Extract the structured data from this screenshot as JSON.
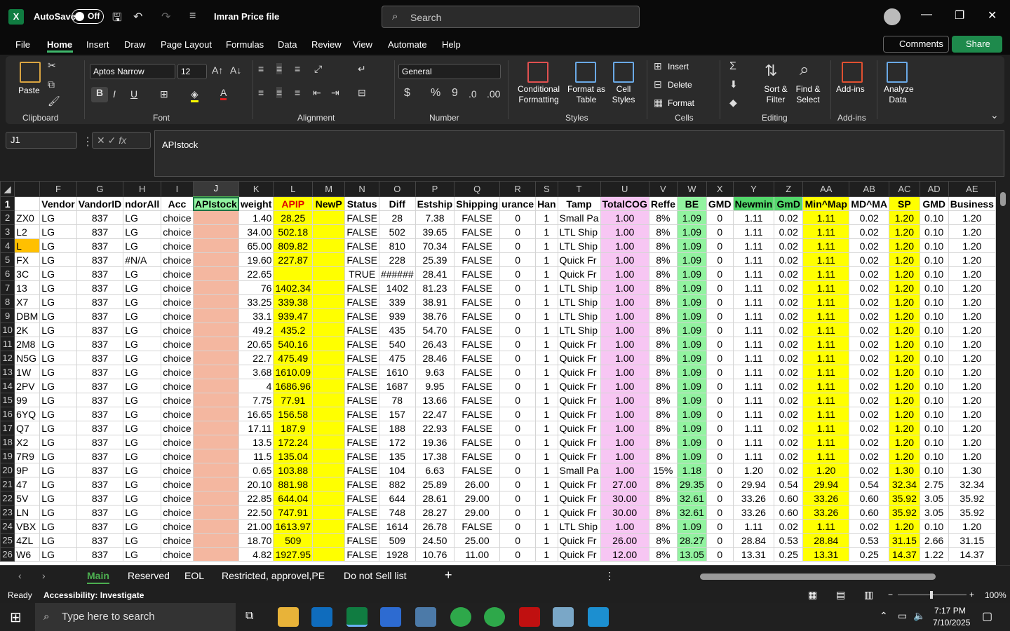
{
  "titlebar": {
    "autosave_label": "AutoSave",
    "autosave_state": "Off",
    "filename": "Imran Price file",
    "search_placeholder": "Search"
  },
  "menu": [
    "File",
    "Home",
    "Insert",
    "Draw",
    "Page Layout",
    "Formulas",
    "Data",
    "Review",
    "View",
    "Automate",
    "Help"
  ],
  "menu_active": "Home",
  "comments_label": "Comments",
  "share_label": "Share",
  "ribbon": {
    "clipboard": {
      "label": "Clipboard",
      "paste": "Paste"
    },
    "font": {
      "label": "Font",
      "name": "Aptos Narrow",
      "size": "12",
      "bold": "B",
      "italic": "I",
      "underline": "U"
    },
    "alignment": {
      "label": "Alignment"
    },
    "number": {
      "label": "Number",
      "format": "General",
      "currency": "$",
      "percent": "%",
      "comma": "9"
    },
    "styles": {
      "label": "Styles",
      "conditional": "Conditional Formatting",
      "format_table": "Format as Table",
      "cell_styles": "Cell Styles"
    },
    "cells": {
      "label": "Cells",
      "insert": "Insert",
      "delete": "Delete",
      "format": "Format"
    },
    "editing": {
      "label": "Editing",
      "sort": "Sort & Filter",
      "find": "Find & Select"
    },
    "addins": {
      "label": "Add-ins",
      "addins": "Add-ins",
      "analyze": "Analyze Data"
    }
  },
  "formula_bar": {
    "name_box": "J1",
    "fx": "fx",
    "content": "APIstock"
  },
  "columns": [
    "F",
    "G",
    "H",
    "I",
    "J",
    "K",
    "L",
    "M",
    "N",
    "O",
    "P",
    "Q",
    "R",
    "S",
    "T",
    "U",
    "V",
    "W",
    "X",
    "Y",
    "Z",
    "AA",
    "AB",
    "AC",
    "AD",
    "AE"
  ],
  "header_row": [
    "Vendor",
    "VandorID",
    "ndorAll",
    "Acc",
    "APIstock",
    "weight",
    "APIP",
    "NewP",
    "Status",
    "Diff",
    "Estship",
    "Shipping",
    "urance",
    "Han",
    "Tamp",
    "TotalCOG",
    "Reffe",
    "BE",
    "GMD",
    "Newmin",
    "GmD",
    "Min^Map",
    "MD^MA",
    "SP",
    "GMD",
    "Business"
  ],
  "rows": [
    {
      "n": "2",
      "e": "ZX0",
      "h": "LG",
      "k": "1.40",
      "l": "28.25",
      "n_": "FALSE",
      "o": "28",
      "p": "7.38",
      "t": "Small Pa",
      "u": "1.00",
      "v": "8%",
      "w": "1.09",
      "y": "1.11",
      "z": "0.02",
      "aa": "1.11",
      "ab": "0.02",
      "ac": "1.20",
      "ad": "0.10",
      "ae": "1.20"
    },
    {
      "n": "3",
      "e": "L2",
      "h": "LG",
      "k": "34.00",
      "l": "502.18",
      "n_": "FALSE",
      "o": "502",
      "p": "39.65",
      "t": "LTL Ship",
      "u": "1.00",
      "v": "8%",
      "w": "1.09",
      "y": "1.11",
      "z": "0.02",
      "aa": "1.11",
      "ab": "0.02",
      "ac": "1.20",
      "ad": "0.10",
      "ae": "1.20"
    },
    {
      "n": "4",
      "e": "L",
      "h": "LG",
      "k": "65.00",
      "l": "809.82",
      "n_": "FALSE",
      "o": "810",
      "p": "70.34",
      "t": "LTL Ship",
      "u": "1.00",
      "v": "8%",
      "w": "1.09",
      "y": "1.11",
      "z": "0.02",
      "aa": "1.11",
      "ab": "0.02",
      "ac": "1.20",
      "ad": "0.10",
      "ae": "1.20"
    },
    {
      "n": "5",
      "e": "FX",
      "h": "#N/A",
      "k": "19.60",
      "l": "227.87",
      "n_": "FALSE",
      "o": "228",
      "p": "25.39",
      "t": "Quick Fr",
      "u": "1.00",
      "v": "8%",
      "w": "1.09",
      "y": "1.11",
      "z": "0.02",
      "aa": "1.11",
      "ab": "0.02",
      "ac": "1.20",
      "ad": "0.10",
      "ae": "1.20"
    },
    {
      "n": "6",
      "e": "3C",
      "h": "LG",
      "k": "22.65",
      "l": "",
      "n_": "TRUE",
      "o": "######",
      "p": "28.41",
      "t": "Quick Fr",
      "u": "1.00",
      "v": "8%",
      "w": "1.09",
      "y": "1.11",
      "z": "0.02",
      "aa": "1.11",
      "ab": "0.02",
      "ac": "1.20",
      "ad": "0.10",
      "ae": "1.20"
    },
    {
      "n": "7",
      "e": "13",
      "h": "LG",
      "k": "76",
      "l": "1402.34",
      "n_": "FALSE",
      "o": "1402",
      "p": "81.23",
      "t": "LTL Ship",
      "u": "1.00",
      "v": "8%",
      "w": "1.09",
      "y": "1.11",
      "z": "0.02",
      "aa": "1.11",
      "ab": "0.02",
      "ac": "1.20",
      "ad": "0.10",
      "ae": "1.20"
    },
    {
      "n": "8",
      "e": "X7",
      "h": "LG",
      "k": "33.25",
      "l": "339.38",
      "n_": "FALSE",
      "o": "339",
      "p": "38.91",
      "t": "LTL Ship",
      "u": "1.00",
      "v": "8%",
      "w": "1.09",
      "y": "1.11",
      "z": "0.02",
      "aa": "1.11",
      "ab": "0.02",
      "ac": "1.20",
      "ad": "0.10",
      "ae": "1.20"
    },
    {
      "n": "9",
      "e": "DBM",
      "h": "LG",
      "k": "33.1",
      "l": "939.47",
      "n_": "FALSE",
      "o": "939",
      "p": "38.76",
      "t": "LTL Ship",
      "u": "1.00",
      "v": "8%",
      "w": "1.09",
      "y": "1.11",
      "z": "0.02",
      "aa": "1.11",
      "ab": "0.02",
      "ac": "1.20",
      "ad": "0.10",
      "ae": "1.20"
    },
    {
      "n": "10",
      "e": "2K",
      "h": "LG",
      "k": "49.2",
      "l": "435.2",
      "n_": "FALSE",
      "o": "435",
      "p": "54.70",
      "t": "LTL Ship",
      "u": "1.00",
      "v": "8%",
      "w": "1.09",
      "y": "1.11",
      "z": "0.02",
      "aa": "1.11",
      "ab": "0.02",
      "ac": "1.20",
      "ad": "0.10",
      "ae": "1.20"
    },
    {
      "n": "11",
      "e": "2M8",
      "h": "LG",
      "k": "20.65",
      "l": "540.16",
      "n_": "FALSE",
      "o": "540",
      "p": "26.43",
      "t": "Quick Fr",
      "u": "1.00",
      "v": "8%",
      "w": "1.09",
      "y": "1.11",
      "z": "0.02",
      "aa": "1.11",
      "ab": "0.02",
      "ac": "1.20",
      "ad": "0.10",
      "ae": "1.20"
    },
    {
      "n": "12",
      "e": "N5G",
      "h": "LG",
      "k": "22.7",
      "l": "475.49",
      "n_": "FALSE",
      "o": "475",
      "p": "28.46",
      "t": "Quick Fr",
      "u": "1.00",
      "v": "8%",
      "w": "1.09",
      "y": "1.11",
      "z": "0.02",
      "aa": "1.11",
      "ab": "0.02",
      "ac": "1.20",
      "ad": "0.10",
      "ae": "1.20"
    },
    {
      "n": "13",
      "e": "1W",
      "h": "LG",
      "k": "3.68",
      "l": "1610.09",
      "n_": "FALSE",
      "o": "1610",
      "p": "9.63",
      "t": "Quick Fr",
      "u": "1.00",
      "v": "8%",
      "w": "1.09",
      "y": "1.11",
      "z": "0.02",
      "aa": "1.11",
      "ab": "0.02",
      "ac": "1.20",
      "ad": "0.10",
      "ae": "1.20"
    },
    {
      "n": "14",
      "e": "2PV",
      "h": "LG",
      "k": "4",
      "l": "1686.96",
      "n_": "FALSE",
      "o": "1687",
      "p": "9.95",
      "t": "Quick Fr",
      "u": "1.00",
      "v": "8%",
      "w": "1.09",
      "y": "1.11",
      "z": "0.02",
      "aa": "1.11",
      "ab": "0.02",
      "ac": "1.20",
      "ad": "0.10",
      "ae": "1.20"
    },
    {
      "n": "15",
      "e": "99",
      "h": "LG",
      "k": "7.75",
      "l": "77.91",
      "n_": "FALSE",
      "o": "78",
      "p": "13.66",
      "t": "Quick Fr",
      "u": "1.00",
      "v": "8%",
      "w": "1.09",
      "y": "1.11",
      "z": "0.02",
      "aa": "1.11",
      "ab": "0.02",
      "ac": "1.20",
      "ad": "0.10",
      "ae": "1.20"
    },
    {
      "n": "16",
      "e": "6YQ",
      "h": "LG",
      "k": "16.65",
      "l": "156.58",
      "n_": "FALSE",
      "o": "157",
      "p": "22.47",
      "t": "Quick Fr",
      "u": "1.00",
      "v": "8%",
      "w": "1.09",
      "y": "1.11",
      "z": "0.02",
      "aa": "1.11",
      "ab": "0.02",
      "ac": "1.20",
      "ad": "0.10",
      "ae": "1.20"
    },
    {
      "n": "17",
      "e": "Q7",
      "h": "LG",
      "k": "17.11",
      "l": "187.9",
      "n_": "FALSE",
      "o": "188",
      "p": "22.93",
      "t": "Quick Fr",
      "u": "1.00",
      "v": "8%",
      "w": "1.09",
      "y": "1.11",
      "z": "0.02",
      "aa": "1.11",
      "ab": "0.02",
      "ac": "1.20",
      "ad": "0.10",
      "ae": "1.20"
    },
    {
      "n": "18",
      "e": "X2",
      "h": "LG",
      "k": "13.5",
      "l": "172.24",
      "n_": "FALSE",
      "o": "172",
      "p": "19.36",
      "t": "Quick Fr",
      "u": "1.00",
      "v": "8%",
      "w": "1.09",
      "y": "1.11",
      "z": "0.02",
      "aa": "1.11",
      "ab": "0.02",
      "ac": "1.20",
      "ad": "0.10",
      "ae": "1.20"
    },
    {
      "n": "19",
      "e": "7R9",
      "h": "LG",
      "k": "11.5",
      "l": "135.04",
      "n_": "FALSE",
      "o": "135",
      "p": "17.38",
      "t": "Quick Fr",
      "u": "1.00",
      "v": "8%",
      "w": "1.09",
      "y": "1.11",
      "z": "0.02",
      "aa": "1.11",
      "ab": "0.02",
      "ac": "1.20",
      "ad": "0.10",
      "ae": "1.20"
    },
    {
      "n": "20",
      "e": "9P",
      "h": "LG",
      "k": "0.65",
      "l": "103.88",
      "n_": "FALSE",
      "o": "104",
      "p": "6.63",
      "t": "Small Pa",
      "u": "1.00",
      "v": "15%",
      "w": "1.18",
      "y": "1.20",
      "z": "0.02",
      "aa": "1.20",
      "ab": "0.02",
      "ac": "1.30",
      "ad": "0.10",
      "ae": "1.30"
    },
    {
      "n": "21",
      "e": "47",
      "h": "LG",
      "k": "20.10",
      "l": "881.98",
      "n_": "FALSE",
      "o": "882",
      "p": "25.89",
      "q": "26.00",
      "t": "Quick Fr",
      "u": "27.00",
      "v": "8%",
      "w": "29.35",
      "y": "29.94",
      "z": "0.54",
      "aa": "29.94",
      "ab": "0.54",
      "ac": "32.34",
      "ad": "2.75",
      "ae": "32.34"
    },
    {
      "n": "22",
      "e": "5V",
      "h": "LG",
      "k": "22.85",
      "l": "644.04",
      "n_": "FALSE",
      "o": "644",
      "p": "28.61",
      "q": "29.00",
      "t": "Quick Fr",
      "u": "30.00",
      "v": "8%",
      "w": "32.61",
      "y": "33.26",
      "z": "0.60",
      "aa": "33.26",
      "ab": "0.60",
      "ac": "35.92",
      "ad": "3.05",
      "ae": "35.92"
    },
    {
      "n": "23",
      "e": "LN",
      "h": "LG",
      "k": "22.50",
      "l": "747.91",
      "n_": "FALSE",
      "o": "748",
      "p": "28.27",
      "q": "29.00",
      "t": "Quick Fr",
      "u": "30.00",
      "v": "8%",
      "w": "32.61",
      "y": "33.26",
      "z": "0.60",
      "aa": "33.26",
      "ab": "0.60",
      "ac": "35.92",
      "ad": "3.05",
      "ae": "35.92"
    },
    {
      "n": "24",
      "e": "VBX",
      "h": "LG",
      "k": "21.00",
      "l": "1613.97",
      "n_": "FALSE",
      "o": "1614",
      "p": "26.78",
      "t": "LTL Ship",
      "u": "1.00",
      "v": "8%",
      "w": "1.09",
      "y": "1.11",
      "z": "0.02",
      "aa": "1.11",
      "ab": "0.02",
      "ac": "1.20",
      "ad": "0.10",
      "ae": "1.20"
    },
    {
      "n": "25",
      "e": "4ZL",
      "h": "LG",
      "k": "18.70",
      "l": "509",
      "n_": "FALSE",
      "o": "509",
      "p": "24.50",
      "q": "25.00",
      "t": "Quick Fr",
      "u": "26.00",
      "v": "8%",
      "w": "28.27",
      "y": "28.84",
      "z": "0.53",
      "aa": "28.84",
      "ab": "0.53",
      "ac": "31.15",
      "ad": "2.66",
      "ae": "31.15"
    },
    {
      "n": "26",
      "e": "W6",
      "h": "LG",
      "k": "4.82",
      "l": "1927.95",
      "n_": "FALSE",
      "o": "1928",
      "p": "10.76",
      "q": "11.00",
      "t": "Quick Fr",
      "u": "12.00",
      "v": "8%",
      "w": "13.05",
      "y": "13.31",
      "z": "0.25",
      "aa": "13.31",
      "ab": "0.25",
      "ac": "14.37",
      "ad": "1.22",
      "ae": "14.37"
    }
  ],
  "common": {
    "vendor": "LG",
    "vendor_id": "837",
    "acc": "choice",
    "ship_flag": "FALSE",
    "ins": "0",
    "han": "1",
    "gmd": "0"
  },
  "sheet_tabs": [
    "Main",
    "Reserved",
    "EOL",
    "Restricted, approvel,PE",
    "Do not Sell list"
  ],
  "status": {
    "ready": "Ready",
    "accessibility": "Accessibility: Investigate",
    "zoom": "100%"
  },
  "taskbar": {
    "search_placeholder": "Type here to search",
    "time": "7:17 PM",
    "date": "7/10/2025"
  }
}
